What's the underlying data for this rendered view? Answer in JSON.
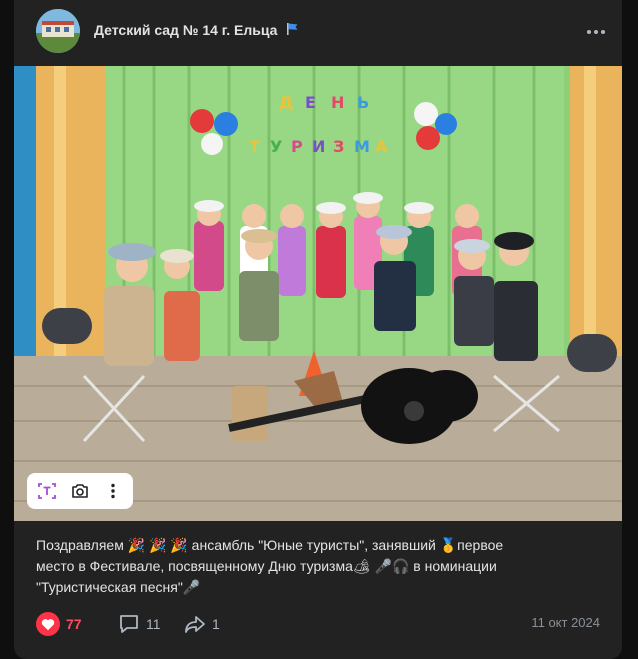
{
  "post": {
    "group_name": "Детский сад № 14 г. Ельца",
    "flag_icon": "blue-flag-icon",
    "banner_letters": [
      "Д",
      "Е",
      "Н",
      "Ь",
      "Т",
      "У",
      "Р",
      "И",
      "З",
      "М",
      "А"
    ],
    "text_line1": "Поздравляем 🎉 🎉 🎉 ансамбль \"Юные туристы\", занявший 🥇первое",
    "text_line2": "место в Фестивале, посвященному Дню туризма🏕 🎤🎧 в номинации",
    "text_line3": "\"Туристическая песня\"🎤",
    "likes": "77",
    "comments": "11",
    "shares": "1",
    "date": "11 окт 2024"
  },
  "colors": {
    "background": "#0f0f0f",
    "card": "#222222",
    "like_red": "#ff3347",
    "muted": "#aeb7c2"
  }
}
